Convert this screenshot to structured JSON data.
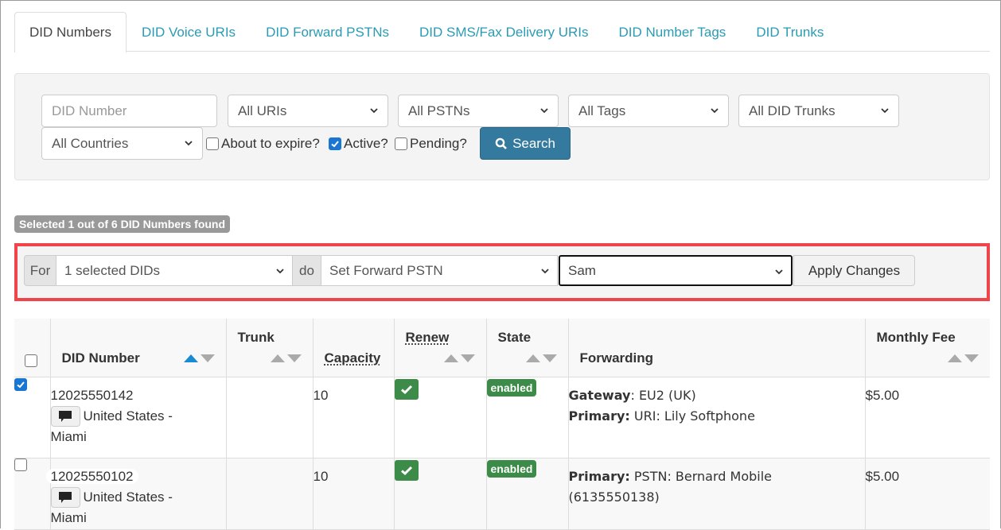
{
  "tabs": [
    {
      "label": "DID Numbers",
      "active": true
    },
    {
      "label": "DID Voice URIs",
      "active": false
    },
    {
      "label": "DID Forward PSTNs",
      "active": false
    },
    {
      "label": "DID SMS/Fax Delivery URIs",
      "active": false
    },
    {
      "label": "DID Number Tags",
      "active": false
    },
    {
      "label": "DID Trunks",
      "active": false
    }
  ],
  "filters": {
    "did_number_placeholder": "DID Number",
    "uris": "All URIs",
    "pstns": "All PSTNs",
    "tags": "All Tags",
    "trunks": "All DID Trunks",
    "countries": "All Countries",
    "about_to_expire": {
      "label": "About to expire?",
      "checked": false
    },
    "active": {
      "label": "Active?",
      "checked": true
    },
    "pending": {
      "label": "Pending?",
      "checked": false
    },
    "search_label": "Search"
  },
  "selection_summary": "Selected 1 out of 6 DID Numbers found",
  "bulk_action": {
    "for_label": "For",
    "target": "1 selected DIDs",
    "do_label": "do",
    "action": "Set Forward PSTN",
    "value": "Sam",
    "apply_label": "Apply Changes"
  },
  "table": {
    "columns": {
      "did_number": "DID Number",
      "trunk": "Trunk",
      "capacity": "Capacity",
      "renew": "Renew",
      "state": "State",
      "forwarding": "Forwarding",
      "monthly_fee": "Monthly Fee"
    },
    "rows": [
      {
        "selected": true,
        "did_number": "12025550142",
        "location_line1": "United States -",
        "location_line2": "Miami",
        "trunk": "",
        "capacity": "10",
        "renew": true,
        "state": "enabled",
        "forwarding": [
          {
            "key": "Gateway",
            "sep": ": ",
            "value": "EU2 (UK)"
          },
          {
            "key": "Primary:",
            "sep": " ",
            "value": "URI: Lily Softphone"
          }
        ],
        "monthly_fee": "$5.00"
      },
      {
        "selected": false,
        "did_number": "12025550102",
        "location_line1": "United States -",
        "location_line2": "Miami",
        "trunk": "",
        "capacity": "10",
        "renew": true,
        "state": "enabled",
        "forwarding": [
          {
            "key": "Primary:",
            "sep": " ",
            "value": "PSTN: Bernard Mobile (6135550138)"
          }
        ],
        "monthly_fee": "$5.00"
      }
    ]
  },
  "colors": {
    "tab_link": "#2a9bb4",
    "search_button": "#337a9e",
    "highlight_border": "#f0444a",
    "success": "#3d8b48",
    "sort_active": "#1a8ad2",
    "checkbox_checked": "#1976d2"
  }
}
